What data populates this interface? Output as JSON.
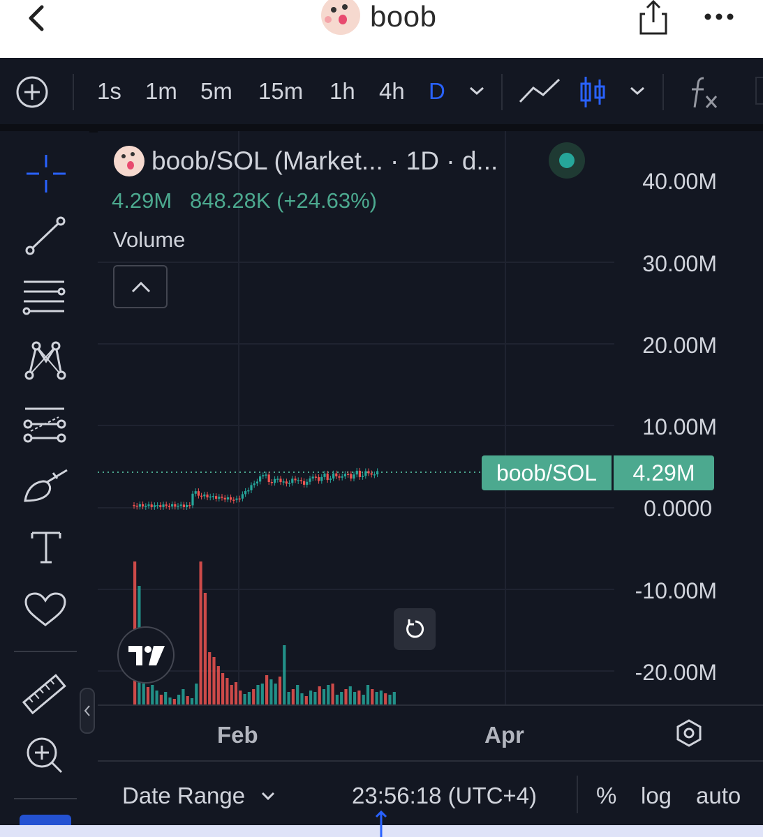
{
  "app": {
    "title": "boob"
  },
  "toolbar": {
    "timeframes": [
      "1s",
      "1m",
      "5m",
      "15m",
      "1h",
      "4h",
      "D"
    ],
    "active_timeframe": "D"
  },
  "legend": {
    "symbol_title": "boob/SOL (Market... · 1D · d...",
    "price": "4.29M",
    "change": "848.28K (+24.63%)",
    "indicator": "Volume"
  },
  "y_axis": {
    "labels": [
      "40.00M",
      "30.00M",
      "20.00M",
      "10.00M",
      "0.0000",
      "-10.00M",
      "-20.00M"
    ]
  },
  "price_tag": {
    "symbol": "boob/SOL",
    "value": "4.29M"
  },
  "x_axis": {
    "labels": [
      "Feb",
      "Apr"
    ]
  },
  "bottom_bar": {
    "date_range": "Date Range",
    "time": "23:56:18 (UTC+4)",
    "percent": "%",
    "log": "log",
    "auto": "auto"
  },
  "colors": {
    "up": "#26a69a",
    "down": "#ef5350",
    "accent": "#2962ff",
    "tag": "#4ca98f",
    "bg": "#131722"
  }
}
